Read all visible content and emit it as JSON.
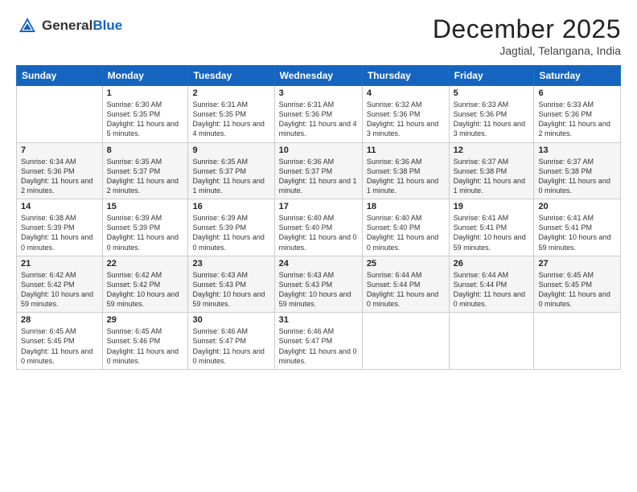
{
  "header": {
    "logo_general": "General",
    "logo_blue": "Blue",
    "month_title": "December 2025",
    "subtitle": "Jagtial, Telangana, India"
  },
  "days_of_week": [
    "Sunday",
    "Monday",
    "Tuesday",
    "Wednesday",
    "Thursday",
    "Friday",
    "Saturday"
  ],
  "weeks": [
    [
      {
        "day": "",
        "sunrise": "",
        "sunset": "",
        "daylight": ""
      },
      {
        "day": "1",
        "sunrise": "Sunrise: 6:30 AM",
        "sunset": "Sunset: 5:35 PM",
        "daylight": "Daylight: 11 hours and 5 minutes."
      },
      {
        "day": "2",
        "sunrise": "Sunrise: 6:31 AM",
        "sunset": "Sunset: 5:35 PM",
        "daylight": "Daylight: 11 hours and 4 minutes."
      },
      {
        "day": "3",
        "sunrise": "Sunrise: 6:31 AM",
        "sunset": "Sunset: 5:36 PM",
        "daylight": "Daylight: 11 hours and 4 minutes."
      },
      {
        "day": "4",
        "sunrise": "Sunrise: 6:32 AM",
        "sunset": "Sunset: 5:36 PM",
        "daylight": "Daylight: 11 hours and 3 minutes."
      },
      {
        "day": "5",
        "sunrise": "Sunrise: 6:33 AM",
        "sunset": "Sunset: 5:36 PM",
        "daylight": "Daylight: 11 hours and 3 minutes."
      },
      {
        "day": "6",
        "sunrise": "Sunrise: 6:33 AM",
        "sunset": "Sunset: 5:36 PM",
        "daylight": "Daylight: 11 hours and 2 minutes."
      }
    ],
    [
      {
        "day": "7",
        "sunrise": "Sunrise: 6:34 AM",
        "sunset": "Sunset: 5:36 PM",
        "daylight": "Daylight: 11 hours and 2 minutes."
      },
      {
        "day": "8",
        "sunrise": "Sunrise: 6:35 AM",
        "sunset": "Sunset: 5:37 PM",
        "daylight": "Daylight: 11 hours and 2 minutes."
      },
      {
        "day": "9",
        "sunrise": "Sunrise: 6:35 AM",
        "sunset": "Sunset: 5:37 PM",
        "daylight": "Daylight: 11 hours and 1 minute."
      },
      {
        "day": "10",
        "sunrise": "Sunrise: 6:36 AM",
        "sunset": "Sunset: 5:37 PM",
        "daylight": "Daylight: 11 hours and 1 minute."
      },
      {
        "day": "11",
        "sunrise": "Sunrise: 6:36 AM",
        "sunset": "Sunset: 5:38 PM",
        "daylight": "Daylight: 11 hours and 1 minute."
      },
      {
        "day": "12",
        "sunrise": "Sunrise: 6:37 AM",
        "sunset": "Sunset: 5:38 PM",
        "daylight": "Daylight: 11 hours and 1 minute."
      },
      {
        "day": "13",
        "sunrise": "Sunrise: 6:37 AM",
        "sunset": "Sunset: 5:38 PM",
        "daylight": "Daylight: 11 hours and 0 minutes."
      }
    ],
    [
      {
        "day": "14",
        "sunrise": "Sunrise: 6:38 AM",
        "sunset": "Sunset: 5:39 PM",
        "daylight": "Daylight: 11 hours and 0 minutes."
      },
      {
        "day": "15",
        "sunrise": "Sunrise: 6:39 AM",
        "sunset": "Sunset: 5:39 PM",
        "daylight": "Daylight: 11 hours and 0 minutes."
      },
      {
        "day": "16",
        "sunrise": "Sunrise: 6:39 AM",
        "sunset": "Sunset: 5:39 PM",
        "daylight": "Daylight: 11 hours and 0 minutes."
      },
      {
        "day": "17",
        "sunrise": "Sunrise: 6:40 AM",
        "sunset": "Sunset: 5:40 PM",
        "daylight": "Daylight: 11 hours and 0 minutes."
      },
      {
        "day": "18",
        "sunrise": "Sunrise: 6:40 AM",
        "sunset": "Sunset: 5:40 PM",
        "daylight": "Daylight: 11 hours and 0 minutes."
      },
      {
        "day": "19",
        "sunrise": "Sunrise: 6:41 AM",
        "sunset": "Sunset: 5:41 PM",
        "daylight": "Daylight: 10 hours and 59 minutes."
      },
      {
        "day": "20",
        "sunrise": "Sunrise: 6:41 AM",
        "sunset": "Sunset: 5:41 PM",
        "daylight": "Daylight: 10 hours and 59 minutes."
      }
    ],
    [
      {
        "day": "21",
        "sunrise": "Sunrise: 6:42 AM",
        "sunset": "Sunset: 5:42 PM",
        "daylight": "Daylight: 10 hours and 59 minutes."
      },
      {
        "day": "22",
        "sunrise": "Sunrise: 6:42 AM",
        "sunset": "Sunset: 5:42 PM",
        "daylight": "Daylight: 10 hours and 59 minutes."
      },
      {
        "day": "23",
        "sunrise": "Sunrise: 6:43 AM",
        "sunset": "Sunset: 5:43 PM",
        "daylight": "Daylight: 10 hours and 59 minutes."
      },
      {
        "day": "24",
        "sunrise": "Sunrise: 6:43 AM",
        "sunset": "Sunset: 5:43 PM",
        "daylight": "Daylight: 10 hours and 59 minutes."
      },
      {
        "day": "25",
        "sunrise": "Sunrise: 6:44 AM",
        "sunset": "Sunset: 5:44 PM",
        "daylight": "Daylight: 11 hours and 0 minutes."
      },
      {
        "day": "26",
        "sunrise": "Sunrise: 6:44 AM",
        "sunset": "Sunset: 5:44 PM",
        "daylight": "Daylight: 11 hours and 0 minutes."
      },
      {
        "day": "27",
        "sunrise": "Sunrise: 6:45 AM",
        "sunset": "Sunset: 5:45 PM",
        "daylight": "Daylight: 11 hours and 0 minutes."
      }
    ],
    [
      {
        "day": "28",
        "sunrise": "Sunrise: 6:45 AM",
        "sunset": "Sunset: 5:45 PM",
        "daylight": "Daylight: 11 hours and 0 minutes."
      },
      {
        "day": "29",
        "sunrise": "Sunrise: 6:45 AM",
        "sunset": "Sunset: 5:46 PM",
        "daylight": "Daylight: 11 hours and 0 minutes."
      },
      {
        "day": "30",
        "sunrise": "Sunrise: 6:46 AM",
        "sunset": "Sunset: 5:47 PM",
        "daylight": "Daylight: 11 hours and 0 minutes."
      },
      {
        "day": "31",
        "sunrise": "Sunrise: 6:46 AM",
        "sunset": "Sunset: 5:47 PM",
        "daylight": "Daylight: 11 hours and 0 minutes."
      },
      {
        "day": "",
        "sunrise": "",
        "sunset": "",
        "daylight": ""
      },
      {
        "day": "",
        "sunrise": "",
        "sunset": "",
        "daylight": ""
      },
      {
        "day": "",
        "sunrise": "",
        "sunset": "",
        "daylight": ""
      }
    ]
  ]
}
